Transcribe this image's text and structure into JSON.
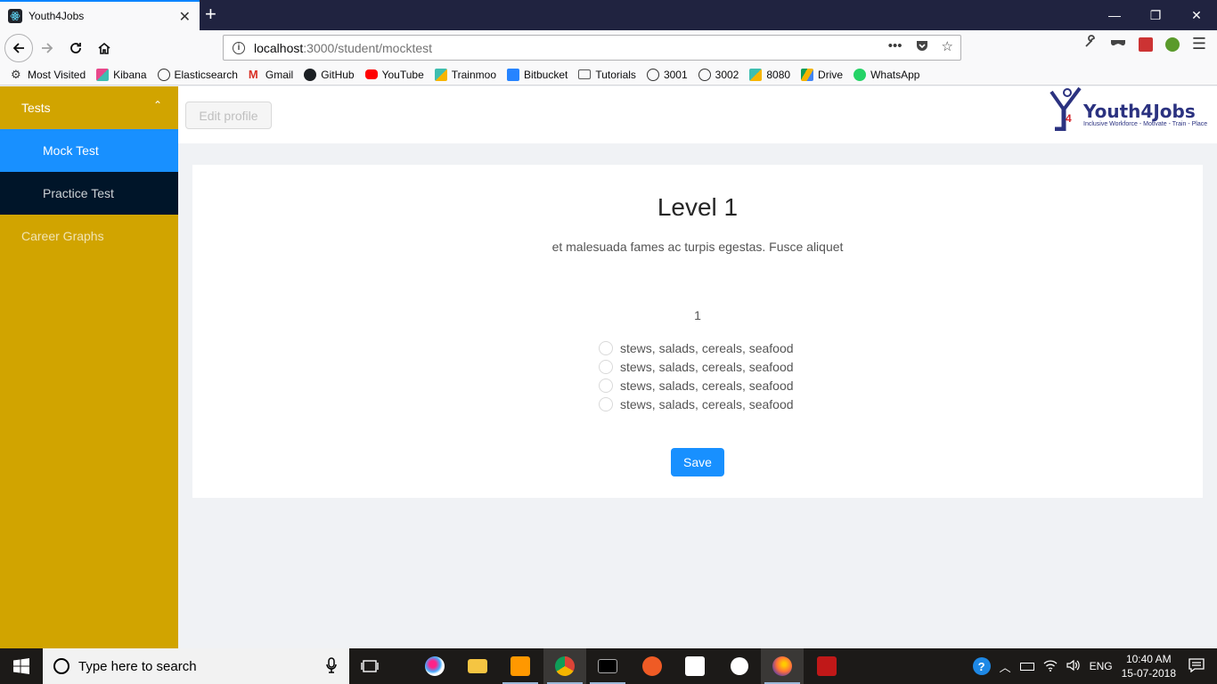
{
  "browser": {
    "tab_title": "Youth4Jobs",
    "url_host": "localhost",
    "url_path": ":3000/student/mocktest",
    "bookmarks": [
      "Most Visited",
      "Kibana",
      "Elasticsearch",
      "Gmail",
      "GitHub",
      "YouTube",
      "Trainmoo",
      "Bitbucket",
      "Tutorials",
      "3001",
      "3002",
      "8080",
      "Drive",
      "WhatsApp"
    ]
  },
  "sidebar": {
    "tests_label": "Tests",
    "mock_test_label": "Mock Test",
    "practice_test_label": "Practice Test",
    "career_graphs_label": "Career Graphs"
  },
  "header": {
    "edit_profile_label": "Edit profile",
    "logo_text": "Youth4Jobs",
    "logo_tagline": "Inclusive Workforce - Motivate - Train - Place"
  },
  "test": {
    "title": "Level 1",
    "description": "et malesuada fames ac turpis egestas. Fusce aliquet",
    "question_number": "1",
    "options": [
      "stews, salads, cereals, seafood",
      "stews, salads, cereals, seafood",
      "stews, salads, cereals, seafood",
      "stews, salads, cereals, seafood"
    ],
    "save_label": "Save"
  },
  "taskbar": {
    "search_placeholder": "Type here to search",
    "language": "ENG",
    "time": "10:40 AM",
    "date": "15-07-2018"
  },
  "colors": {
    "sidebar": "#d1a400",
    "active_item": "#1890ff",
    "submenu": "#001529",
    "primary_button": "#1890ff"
  }
}
